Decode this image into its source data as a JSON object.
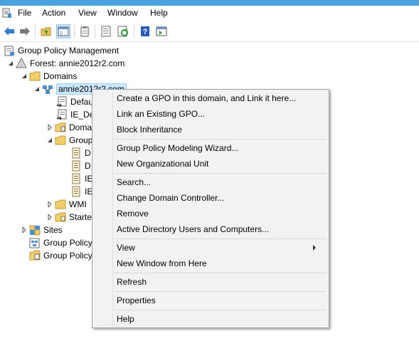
{
  "menubar": {
    "items": [
      "File",
      "Action",
      "View",
      "Window",
      "Help"
    ]
  },
  "toolbar": {
    "buttons": [
      "back-arrow-icon",
      "forward-arrow-icon",
      "up-folder-icon",
      "show-hide-console-tree-icon",
      "clipboard-icon",
      "properties-icon",
      "refresh-icon",
      "help-icon",
      "action-pane-icon"
    ]
  },
  "tree": {
    "root": "Group Policy Management",
    "forest": "Forest: annie2012r2.com",
    "domains": "Domains",
    "domain": "annie2012r2.com",
    "default_policy": "Defau",
    "ie_policy": "IE_De",
    "domain_controllers": "Doma",
    "gpo_container": "Group",
    "gpo1": "D",
    "gpo2": "D",
    "gpo3": "IE",
    "gpo4": "IE",
    "wmi": "WMI",
    "starter": "Starte",
    "sites": "Sites",
    "modeling": "Group Policy",
    "results": "Group Policy"
  },
  "context_menu": {
    "create_gpo": "Create a GPO in this domain, and Link it here...",
    "link_existing": "Link an Existing GPO...",
    "block_inheritance": "Block Inheritance",
    "modeling_wizard": "Group Policy Modeling Wizard...",
    "new_ou": "New Organizational Unit",
    "search": "Search...",
    "change_dc": "Change Domain Controller...",
    "remove": "Remove",
    "ad_users": "Active Directory Users and Computers...",
    "view": "View",
    "new_window": "New Window from Here",
    "refresh": "Refresh",
    "properties": "Properties",
    "help": "Help"
  }
}
